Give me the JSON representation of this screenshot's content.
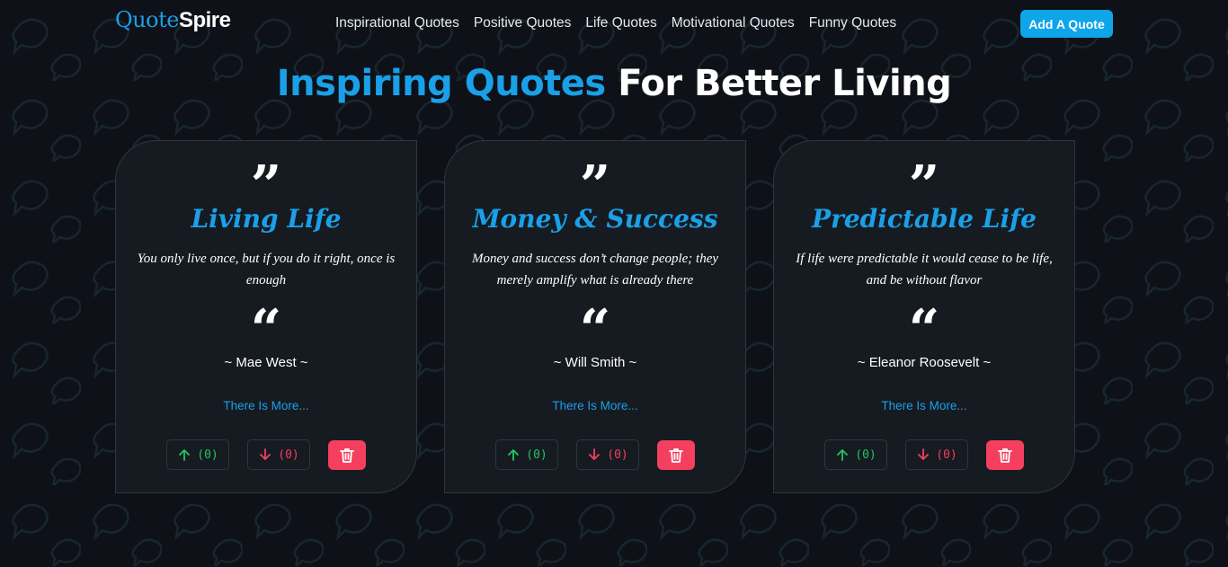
{
  "brand": {
    "part1": "Quote",
    "part2": "Spire"
  },
  "nav": {
    "links": [
      "Inspirational Quotes",
      "Positive Quotes",
      "Life Quotes",
      "Motivational Quotes",
      "Funny Quotes"
    ],
    "add_button": "Add A Quote"
  },
  "hero": {
    "accent": "Inspiring Quotes",
    "rest": "For Better Living"
  },
  "cards": [
    {
      "open_mark": "”",
      "title": "Living Life",
      "text": "You only live once, but if you do it right, once is enough",
      "close_mark": "“",
      "author": "~ Mae West ~",
      "more": "There Is More...",
      "upvotes": "(0)",
      "downvotes": "(0)"
    },
    {
      "open_mark": "”",
      "title": "Money & Success",
      "text": "Money and success don’t change people; they merely amplify what is already there",
      "close_mark": "“",
      "author": "~ Will Smith ~",
      "more": "There Is More...",
      "upvotes": "(0)",
      "downvotes": "(0)"
    },
    {
      "open_mark": "”",
      "title": "Predictable Life",
      "text": "If life were predictable it would cease to be life, and be without flavor",
      "close_mark": "“",
      "author": "~ Eleanor Roosevelt ~",
      "more": "There Is More...",
      "upvotes": "(0)",
      "downvotes": "(0)"
    }
  ],
  "colors": {
    "background": "#0e1117",
    "card": "#161b22",
    "accent": "#1aa0e8",
    "upvote": "#22c55e",
    "downvote": "#f43f5e",
    "delete": "#f43f5e"
  },
  "icons": {
    "upvote": "arrow-up-icon",
    "downvote": "arrow-down-icon",
    "delete": "trash-icon",
    "background": "speech-bubble-pattern"
  }
}
